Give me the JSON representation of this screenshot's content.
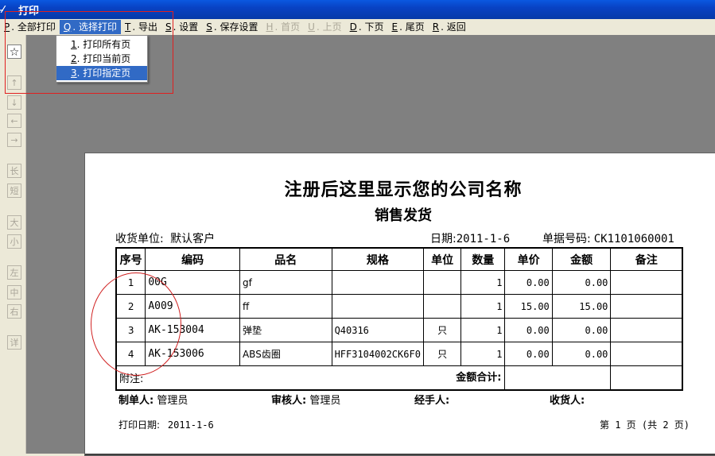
{
  "window": {
    "title": "打印"
  },
  "menu": {
    "items": [
      {
        "key": "P",
        "label": ". 全部打印",
        "state": "normal"
      },
      {
        "key": "Q",
        "label": ". 选择打印",
        "state": "active"
      },
      {
        "key": "T",
        "label": ". 导出",
        "state": "normal"
      },
      {
        "key": "S",
        "label": ". 设置",
        "state": "normal"
      },
      {
        "key": "S",
        "label": ". 保存设置",
        "state": "normal"
      },
      {
        "key": "H",
        "label": ". 首页",
        "state": "disabled"
      },
      {
        "key": "U",
        "label": ". 上页",
        "state": "disabled"
      },
      {
        "key": "D",
        "label": ". 下页",
        "state": "normal"
      },
      {
        "key": "E",
        "label": ". 尾页",
        "state": "normal"
      },
      {
        "key": "R",
        "label": ". 返回",
        "state": "normal"
      }
    ]
  },
  "dropdown": {
    "items": [
      {
        "key": "1",
        "label": ". 打印所有页"
      },
      {
        "key": "2",
        "label": ". 打印当前页"
      },
      {
        "key": "3",
        "label": ". 打印指定页"
      }
    ]
  },
  "toolbar": {
    "star": "☆",
    "up": "↑",
    "down": "↓",
    "left": "←",
    "right": "→",
    "long": "长",
    "short": "短",
    "big": "大",
    "small": "小",
    "align_left": "左",
    "align_center": "中",
    "align_right": "右",
    "detail": "详"
  },
  "doc": {
    "company": "注册后这里显示您的公司名称",
    "title": "销售发货",
    "receiver_label": "收货单位:",
    "receiver_value": "默认客户",
    "date_label": "日期:",
    "date_value": "2011-1-6",
    "docno_label": "单据号码:",
    "docno_value": "CK1101060001",
    "headers": [
      "序号",
      "编码",
      "品名",
      "规格",
      "单位",
      "数量",
      "单价",
      "金额",
      "备注"
    ],
    "rows": [
      {
        "no": "1",
        "code": "00G",
        "name": "gf",
        "spec": "",
        "unit": "",
        "qty": "1",
        "price": "0.00",
        "amount": "0.00",
        "note": ""
      },
      {
        "no": "2",
        "code": "A009",
        "name": "ff",
        "spec": "",
        "unit": "",
        "qty": "1",
        "price": "15.00",
        "amount": "15.00",
        "note": ""
      },
      {
        "no": "3",
        "code": "AK-153004",
        "name": "弹垫",
        "spec": "Q40316",
        "unit": "只",
        "qty": "1",
        "price": "0.00",
        "amount": "0.00",
        "note": ""
      },
      {
        "no": "4",
        "code": "AK-153006",
        "name": "ABS齿圈",
        "spec": "HFF3104002CK6F0",
        "unit": "只",
        "qty": "1",
        "price": "0.00",
        "amount": "0.00",
        "note": ""
      }
    ],
    "remark_label": "附注:",
    "total_label": "金额合计:",
    "maker_label": "制单人:",
    "maker_value": "管理员",
    "reviewer_label": "审核人:",
    "reviewer_value": "管理员",
    "handler_label": "经手人:",
    "consignee_label": "收货人:",
    "print_date_label": "打印日期:",
    "print_date_value": "2011-1-6",
    "page_info": "第 1 页 (共 2 页)"
  },
  "colors": {
    "highlight": "#316ac5",
    "annotation": "#e02020",
    "titlebar": "#0842c4"
  }
}
